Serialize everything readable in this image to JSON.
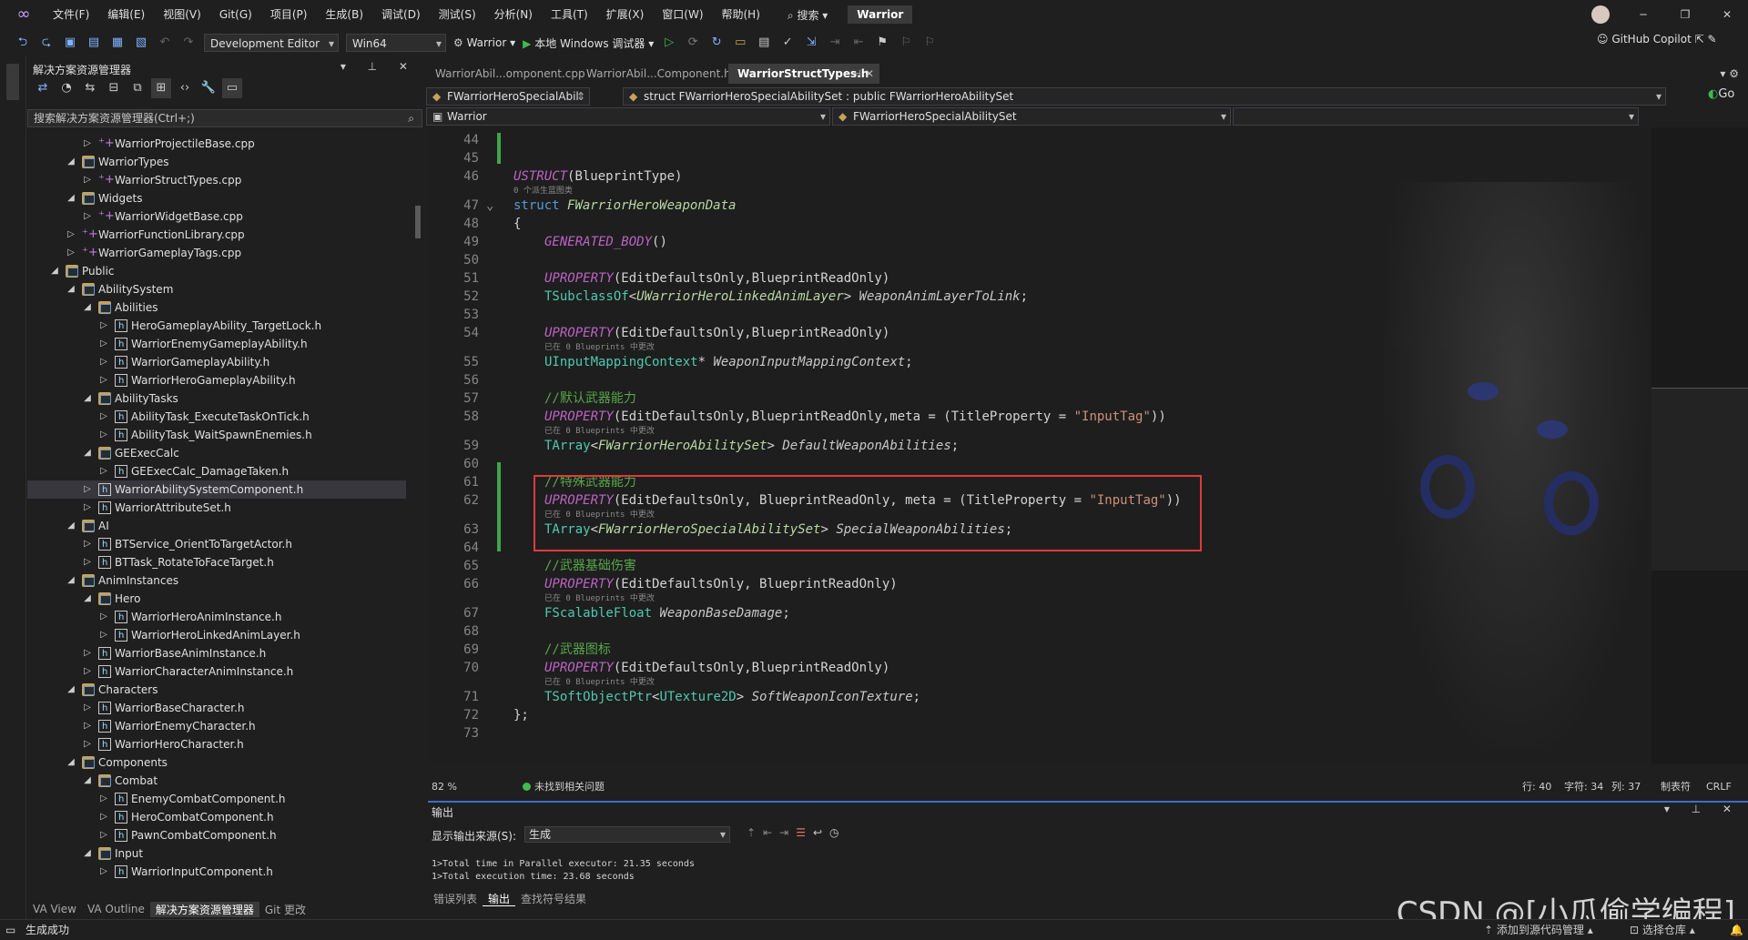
{
  "menu": {
    "items": [
      "文件(F)",
      "编辑(E)",
      "视图(V)",
      "Git(G)",
      "项目(P)",
      "生成(B)",
      "调试(D)",
      "测试(S)",
      "分析(N)",
      "工具(T)",
      "扩展(X)",
      "窗口(W)",
      "帮助(H)"
    ],
    "search": "搜索",
    "solution_name": "Warrior"
  },
  "toolbar": {
    "config": "Development Editor",
    "platform": "Win64",
    "startup_project": "Warrior",
    "debugger": "本地 Windows 调试器",
    "copilot": "GitHub Copilot"
  },
  "solution_explorer": {
    "title": "解决方案资源管理器",
    "search_placeholder": "搜索解决方案资源管理器(Ctrl+;)",
    "tree": [
      {
        "label": "WarriorProjectileBase.cpp",
        "icon": "cpp",
        "depth": 3,
        "arrow": "right"
      },
      {
        "label": "WarriorTypes",
        "icon": "folder",
        "depth": 2,
        "arrow": "down"
      },
      {
        "label": "WarriorStructTypes.cpp",
        "icon": "cpp",
        "depth": 3,
        "arrow": "right"
      },
      {
        "label": "Widgets",
        "icon": "folder",
        "depth": 2,
        "arrow": "down"
      },
      {
        "label": "WarriorWidgetBase.cpp",
        "icon": "cpp",
        "depth": 3,
        "arrow": "right"
      },
      {
        "label": "WarriorFunctionLibrary.cpp",
        "icon": "cpp",
        "depth": 2,
        "arrow": "right"
      },
      {
        "label": "WarriorGameplayTags.cpp",
        "icon": "cpp",
        "depth": 2,
        "arrow": "right"
      },
      {
        "label": "Public",
        "icon": "folder",
        "depth": 1,
        "arrow": "down"
      },
      {
        "label": "AbilitySystem",
        "icon": "folder",
        "depth": 2,
        "arrow": "down"
      },
      {
        "label": "Abilities",
        "icon": "folder",
        "depth": 3,
        "arrow": "down"
      },
      {
        "label": "HeroGameplayAbility_TargetLock.h",
        "icon": "h",
        "depth": 4,
        "arrow": "right"
      },
      {
        "label": "WarriorEnemyGameplayAbility.h",
        "icon": "h",
        "depth": 4,
        "arrow": "right"
      },
      {
        "label": "WarriorGameplayAbility.h",
        "icon": "h",
        "depth": 4,
        "arrow": "right"
      },
      {
        "label": "WarriorHeroGameplayAbility.h",
        "icon": "h",
        "depth": 4,
        "arrow": "right"
      },
      {
        "label": "AbilityTasks",
        "icon": "folder",
        "depth": 3,
        "arrow": "down"
      },
      {
        "label": "AbilityTask_ExecuteTaskOnTick.h",
        "icon": "h",
        "depth": 4,
        "arrow": "right"
      },
      {
        "label": "AbilityTask_WaitSpawnEnemies.h",
        "icon": "h",
        "depth": 4,
        "arrow": "right"
      },
      {
        "label": "GEExecCalc",
        "icon": "folder",
        "depth": 3,
        "arrow": "down"
      },
      {
        "label": "GEExecCalc_DamageTaken.h",
        "icon": "h",
        "depth": 4,
        "arrow": "right"
      },
      {
        "label": "WarriorAbilitySystemComponent.h",
        "icon": "h",
        "depth": 3,
        "arrow": "right",
        "selected": true
      },
      {
        "label": "WarriorAttributeSet.h",
        "icon": "h",
        "depth": 3,
        "arrow": "right"
      },
      {
        "label": "AI",
        "icon": "folder",
        "depth": 2,
        "arrow": "down"
      },
      {
        "label": "BTService_OrientToTargetActor.h",
        "icon": "h",
        "depth": 3,
        "arrow": "right"
      },
      {
        "label": "BTTask_RotateToFaceTarget.h",
        "icon": "h",
        "depth": 3,
        "arrow": "right"
      },
      {
        "label": "AnimInstances",
        "icon": "folder",
        "depth": 2,
        "arrow": "down"
      },
      {
        "label": "Hero",
        "icon": "folder",
        "depth": 3,
        "arrow": "down"
      },
      {
        "label": "WarriorHeroAnimInstance.h",
        "icon": "h",
        "depth": 4,
        "arrow": "right"
      },
      {
        "label": "WarriorHeroLinkedAnimLayer.h",
        "icon": "h",
        "depth": 4,
        "arrow": "right"
      },
      {
        "label": "WarriorBaseAnimInstance.h",
        "icon": "h",
        "depth": 3,
        "arrow": "right"
      },
      {
        "label": "WarriorCharacterAnimInstance.h",
        "icon": "h",
        "depth": 3,
        "arrow": "right"
      },
      {
        "label": "Characters",
        "icon": "folder",
        "depth": 2,
        "arrow": "down"
      },
      {
        "label": "WarriorBaseCharacter.h",
        "icon": "h",
        "depth": 3,
        "arrow": "right"
      },
      {
        "label": "WarriorEnemyCharacter.h",
        "icon": "h",
        "depth": 3,
        "arrow": "right"
      },
      {
        "label": "WarriorHeroCharacter.h",
        "icon": "h",
        "depth": 3,
        "arrow": "right"
      },
      {
        "label": "Components",
        "icon": "folder",
        "depth": 2,
        "arrow": "down"
      },
      {
        "label": "Combat",
        "icon": "folder",
        "depth": 3,
        "arrow": "down"
      },
      {
        "label": "EnemyCombatComponent.h",
        "icon": "h",
        "depth": 4,
        "arrow": "right"
      },
      {
        "label": "HeroCombatComponent.h",
        "icon": "h",
        "depth": 4,
        "arrow": "right"
      },
      {
        "label": "PawnCombatComponent.h",
        "icon": "h",
        "depth": 4,
        "arrow": "right"
      },
      {
        "label": "Input",
        "icon": "folder",
        "depth": 3,
        "arrow": "down"
      },
      {
        "label": "WarriorInputComponent.h",
        "icon": "h",
        "depth": 4,
        "arrow": "right"
      }
    ],
    "bottom_tabs": [
      "VA View",
      "VA Outline",
      "解决方案资源管理器",
      "Git 更改"
    ]
  },
  "editor": {
    "tabs": [
      {
        "label": "WarriorAbil...omponent.cpp",
        "active": false
      },
      {
        "label": "WarriorAbil...Component.h",
        "active": false
      },
      {
        "label": "WarriorStructTypes.h",
        "active": true
      }
    ],
    "nav_scope": "FWarriorHeroSpecialAbil",
    "nav_type": "struct FWarriorHeroSpecialAbilitySet : public FWarriorHeroAbilitySet",
    "nav_project": "Warrior",
    "nav_member": "FWarriorHeroSpecialAbilitySet",
    "go_label": "Go",
    "hint_blueprint_refs": "0 个派生蓝图类",
    "hint_changed_in_blueprints": "已在 0 Blueprints 中更改",
    "lines": {
      "n44": "44",
      "n45": "45",
      "n46": "46",
      "n47": "47",
      "n48": "48",
      "n49": "49",
      "n50": "50",
      "n51": "51",
      "n52": "52",
      "n53": "53",
      "n54": "54",
      "n55": "55",
      "n56": "56",
      "n57": "57",
      "n58": "58",
      "n59": "59",
      "n60": "60",
      "n61": "61",
      "n62": "62",
      "n63": "63",
      "n64": "64",
      "n65": "65",
      "n66": "66",
      "n67": "67",
      "n68": "68",
      "n69": "69",
      "n70": "70",
      "n71": "71",
      "n72": "72",
      "n73": "73"
    },
    "code": {
      "ustruct": "USTRUCT",
      "blueprinttype": "(BlueprintType)",
      "struct_kw": "struct",
      "struct_name": "FWarriorHeroWeaponData",
      "brace_open": "{",
      "brace_close": "};",
      "generated_body": "GENERATED_BODY",
      "parens": "()",
      "uproperty": "UPROPERTY",
      "args_edit_bp": "(EditDefaultsOnly,BlueprintReadOnly)",
      "args_edit_bp_meta": "(EditDefaultsOnly,BlueprintReadOnly,meta = (TitleProperty = ",
      "args_edit_bp_meta_sp": "(EditDefaultsOnly, BlueprintReadOnly, meta = (TitleProperty = ",
      "args_edit_bp_sp": "(EditDefaultsOnly, BlueprintReadOnly)",
      "input_tag_str": "\"InputTag\"",
      "close_meta": "))",
      "tsubclassof": "TSubclassOf",
      "linked_anim_layer": "UWarriorHeroLinkedAnimLayer",
      "weapon_anim_layer": "WeaponAnimLayerToLink",
      "uinputmapping": "UInputMappingContext",
      "weapon_input_mapping": "WeaponInputMappingContext",
      "comment_default": "//默认武器能力",
      "tarray": "TArray",
      "hero_ability_set": "FWarriorHeroAbilitySet",
      "default_abilities": "DefaultWeaponAbilities",
      "comment_special": "//特殊武器能力",
      "hero_special_set": "FWarriorHeroSpecialAbilitySet",
      "special_abilities": "SpecialWeaponAbilities",
      "comment_damage": "//武器基础伤害",
      "fscalablefloat": "FScalableFloat",
      "weapon_base_damage": "WeaponBaseDamage",
      "comment_icon": "//武器图标",
      "tsoftobjectptr": "TSoftObjectPtr",
      "utexture2d": "UTexture2D",
      "soft_icon": "SoftWeaponIconTexture",
      "semicolon": ";",
      "star": "*",
      "lt": "<",
      "gt": ">"
    }
  },
  "edit_status": {
    "zoom": "82 %",
    "issues": "未找到相关问题",
    "line": "行: 40",
    "char": "字符: 34",
    "col": "列: 37",
    "tabs": "制表符",
    "eol": "CRLF"
  },
  "output": {
    "title": "输出",
    "source_label": "显示输出来源(S):",
    "source_value": "生成",
    "lines": [
      "1>Total time in Parallel executor: 21.35 seconds",
      "1>Total execution time: 23.68 seconds"
    ],
    "tabs": [
      "错误列表",
      "输出",
      "查找符号结果"
    ]
  },
  "statusbar": {
    "left": "生成成功",
    "add_source_control": "添加到源代码管理",
    "select_repo": "选择仓库"
  },
  "watermark": "CSDN @[小瓜偷学编程]"
}
